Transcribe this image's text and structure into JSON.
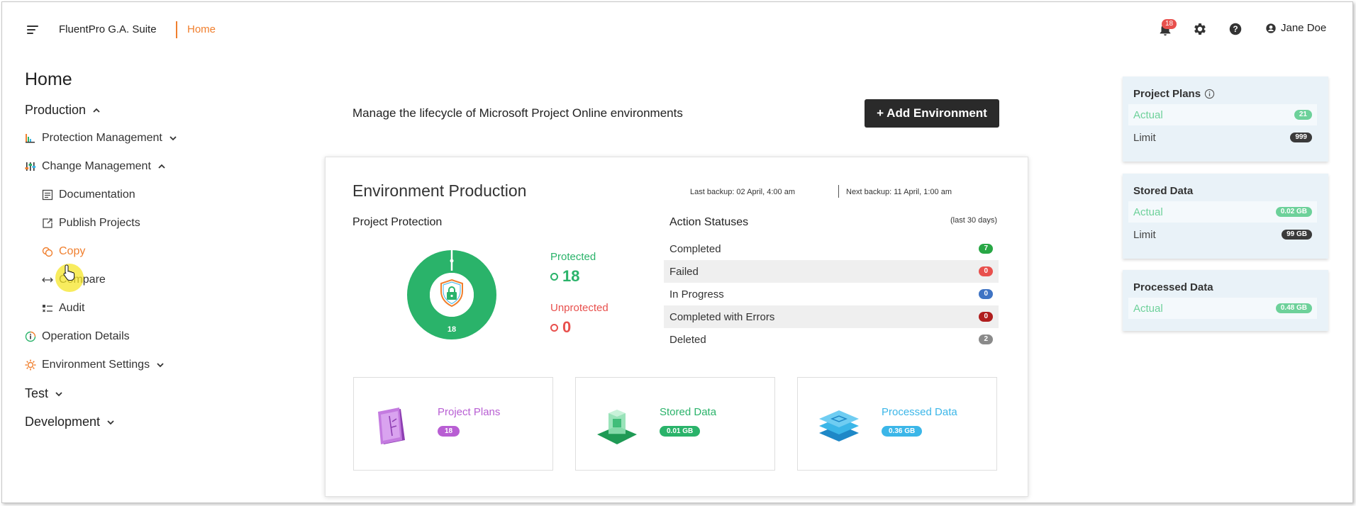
{
  "header": {
    "app_name": "FluentPro G.A. Suite",
    "breadcrumb": "Home",
    "notification_count": "18",
    "user_name": "Jane Doe"
  },
  "sidebar": {
    "page_title": "Home",
    "environments": [
      {
        "label": "Production",
        "expanded": true
      },
      {
        "label": "Test",
        "expanded": false
      },
      {
        "label": "Development",
        "expanded": false
      }
    ],
    "items": {
      "protection_management": "Protection Management",
      "change_management": "Change Management",
      "documentation": "Documentation",
      "publish_projects": "Publish Projects",
      "copy": "Copy",
      "compare": "Compare",
      "audit": "Audit",
      "operation_details": "Operation Details",
      "environment_settings": "Environment Settings"
    },
    "active_item": "copy"
  },
  "main": {
    "subtitle": "Manage the lifecycle of Microsoft Project Online environments",
    "add_button": "+ Add Environment",
    "env_title": "Environment Production",
    "last_backup": "Last backup: 02 April, 4:00 am",
    "next_backup": "Next backup: 11 April, 1:00 am",
    "protection": {
      "title": "Project Protection",
      "total": "18",
      "protected_label": "Protected",
      "protected_value": "18",
      "unprotected_label": "Unprotected",
      "unprotected_value": "0"
    },
    "actions": {
      "title": "Action Statuses",
      "note": "(last 30 days)",
      "rows": [
        {
          "label": "Completed",
          "value": "7",
          "color": "#28a745"
        },
        {
          "label": "Failed",
          "value": "0",
          "color": "#e8504d"
        },
        {
          "label": "In Progress",
          "value": "0",
          "color": "#3f74c4"
        },
        {
          "label": "Completed with Errors",
          "value": "0",
          "color": "#b01e1e"
        },
        {
          "label": "Deleted",
          "value": "2",
          "color": "#8a8a8a"
        }
      ]
    },
    "tiles": [
      {
        "label": "Project Plans",
        "value": "18",
        "color": "#b85ed3"
      },
      {
        "label": "Stored Data",
        "value": "0.01 GB",
        "color": "#2ab36a"
      },
      {
        "label": "Processed Data",
        "value": "0.36 GB",
        "color": "#3bb6e8"
      }
    ]
  },
  "right_panels": {
    "project_plans": {
      "title": "Project Plans",
      "actual_label": "Actual",
      "actual_value": "21",
      "limit_label": "Limit",
      "limit_value": "999"
    },
    "stored_data": {
      "title": "Stored Data",
      "actual_label": "Actual",
      "actual_value": "0.02 GB",
      "limit_label": "Limit",
      "limit_value": "99 GB"
    },
    "processed_data": {
      "title": "Processed Data",
      "actual_label": "Actual",
      "actual_value": "0.48 GB"
    }
  },
  "colors": {
    "accent": "#f07f2e",
    "protected": "#2ab36a",
    "unprotected": "#e8504d",
    "actual_pill": "#6dd19a",
    "limit_pill": "#3a3a3a",
    "panel_bg": "#e9f2f8"
  }
}
